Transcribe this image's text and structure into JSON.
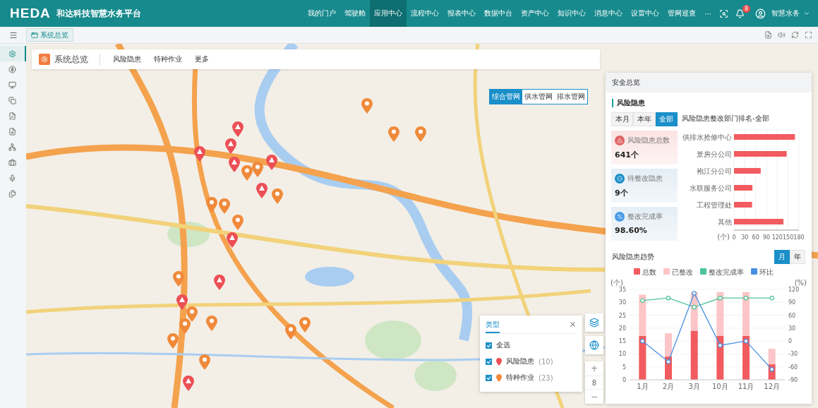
{
  "header": {
    "logo": "HEDA",
    "title": "和达科技智慧水务平台",
    "nav": [
      {
        "label": "我的门户",
        "selected": false
      },
      {
        "label": "驾驶舱",
        "selected": false
      },
      {
        "label": "应用中心",
        "selected": true
      },
      {
        "label": "流程中心",
        "selected": false
      },
      {
        "label": "报表中心",
        "selected": false
      },
      {
        "label": "数据中台",
        "selected": false
      },
      {
        "label": "资产中心",
        "selected": false
      },
      {
        "label": "知识中心",
        "selected": false
      },
      {
        "label": "消息中心",
        "selected": false
      },
      {
        "label": "设置中心",
        "selected": false
      },
      {
        "label": "管网巡查",
        "selected": false
      }
    ],
    "more": "···",
    "badge": "8",
    "user": "智慧水务"
  },
  "tabbar": {
    "tabs": [
      {
        "label": "系统总览",
        "selected": true
      }
    ]
  },
  "sidebar": {
    "items": [
      {
        "kind": "gear",
        "selected": true
      },
      {
        "kind": "coin",
        "selected": false
      },
      {
        "kind": "monitor",
        "selected": false
      },
      {
        "kind": "copy",
        "selected": false
      },
      {
        "kind": "edit",
        "selected": false
      },
      {
        "kind": "file",
        "selected": false
      },
      {
        "kind": "org",
        "selected": false
      },
      {
        "kind": "case",
        "selected": false
      },
      {
        "kind": "mic",
        "selected": false
      },
      {
        "kind": "pages",
        "selected": false
      }
    ]
  },
  "overview": {
    "title": "系统总览",
    "menu": [
      "风险隐患",
      "特种作业",
      "更多"
    ]
  },
  "map": {
    "kind": "picture",
    "layers": [
      {
        "label": "综合管网",
        "selected": true
      },
      {
        "label": "供水管网",
        "selected": false
      },
      {
        "label": "排水管网",
        "selected": false
      }
    ],
    "markers": [
      {
        "kind": "risk"
      },
      {
        "kind": "risk"
      },
      {
        "kind": "risk"
      },
      {
        "kind": "risk"
      },
      {
        "kind": "risk"
      },
      {
        "kind": "risk"
      },
      {
        "kind": "risk"
      },
      {
        "kind": "risk"
      },
      {
        "kind": "risk"
      },
      {
        "kind": "risk"
      },
      {
        "kind": "work"
      },
      {
        "kind": "work"
      },
      {
        "kind": "work"
      },
      {
        "kind": "work"
      },
      {
        "kind": "work"
      },
      {
        "kind": "work"
      },
      {
        "kind": "work"
      },
      {
        "kind": "work"
      },
      {
        "kind": "work"
      },
      {
        "kind": "work"
      },
      {
        "kind": "work"
      },
      {
        "kind": "work"
      },
      {
        "kind": "work"
      },
      {
        "kind": "work"
      },
      {
        "kind": "work"
      },
      {
        "kind": "work"
      },
      {
        "kind": "work"
      }
    ]
  },
  "panel": {
    "title": "安全总览",
    "section": "风险隐患",
    "periods": [
      {
        "label": "本月",
        "selected": false
      },
      {
        "label": "本年",
        "selected": false
      },
      {
        "label": "全部",
        "selected": true
      }
    ],
    "stats": [
      {
        "kind": "total",
        "label": "风险隐患总数",
        "value": "641个"
      },
      {
        "kind": "pending",
        "label": "待整改隐患",
        "value": "9个"
      },
      {
        "kind": "rate",
        "label": "整改完成率",
        "value": "98.60%"
      }
    ],
    "ranking": {
      "chart_data": {
        "type": "bar",
        "orientation": "horizontal",
        "grid": true,
        "title": "风险隐患整改部门排名-全部",
        "categories": [
          "供排水抢修中心",
          "景房分公司",
          "袍江分公司",
          "水联服务公司",
          "工程管理处",
          "其他"
        ],
        "xlabel": "(个)",
        "xlim": [
          0,
          180
        ],
        "xticks": [
          0,
          30,
          60,
          90,
          120,
          150,
          180
        ],
        "series": [
          {
            "color": "#f25b5f",
            "values": [
              169,
              146,
              74,
              51,
              50,
              137
            ]
          }
        ]
      }
    },
    "trend": {
      "title": "风险隐患趋势",
      "ranges": [
        {
          "label": "月",
          "selected": true
        },
        {
          "label": "年",
          "selected": false
        }
      ],
      "bars": {
        "chart_data": {
          "type": "bar",
          "stacked": true,
          "legend": "top",
          "grid": true,
          "categories": [
            "1月",
            "2月",
            "3月",
            "10月",
            "11月",
            "12月"
          ],
          "ylabel": "(个)",
          "ylim": [
            0,
            35
          ],
          "yticks": [
            0,
            5,
            10,
            15,
            20,
            25,
            30,
            35
          ],
          "series": [
            {
              "name": "总数",
              "color": "#f25b5f",
              "values": [
                17,
                9,
                19,
                17,
                17,
                6
              ]
            },
            {
              "name": "已整改",
              "color": "#fcc5c7",
              "values": [
                16,
                9,
                15,
                17,
                17,
                6
              ]
            }
          ]
        }
      },
      "lines": {
        "chart_data": {
          "type": "line",
          "legend": "top",
          "ylabel": "(%)",
          "ylim": [
            -90,
            120
          ],
          "yticks": [
            -90,
            -60,
            -30,
            0,
            30,
            60,
            90,
            120
          ],
          "series": [
            {
              "name": "整改完成率",
              "color": "#4cc495",
              "marker": "circle",
              "values": [
                94,
                100,
                79,
                100,
                100,
                100
              ]
            },
            {
              "name": "环比",
              "color": "#4a90e2",
              "marker": "circle",
              "values": [
                0,
                -48,
                111,
                -10,
                0,
                -66
              ]
            }
          ]
        }
      }
    }
  },
  "filter": {
    "tab": "类型",
    "all": {
      "label": "全选",
      "checked": true
    },
    "items": [
      {
        "kind": "risk",
        "label": "风险隐患",
        "count": "(10)",
        "checked": true
      },
      {
        "kind": "work",
        "label": "特种作业",
        "count": "(23)",
        "checked": true
      }
    ]
  },
  "zoom": {
    "plus": "+",
    "level": "8",
    "minus": "−"
  }
}
